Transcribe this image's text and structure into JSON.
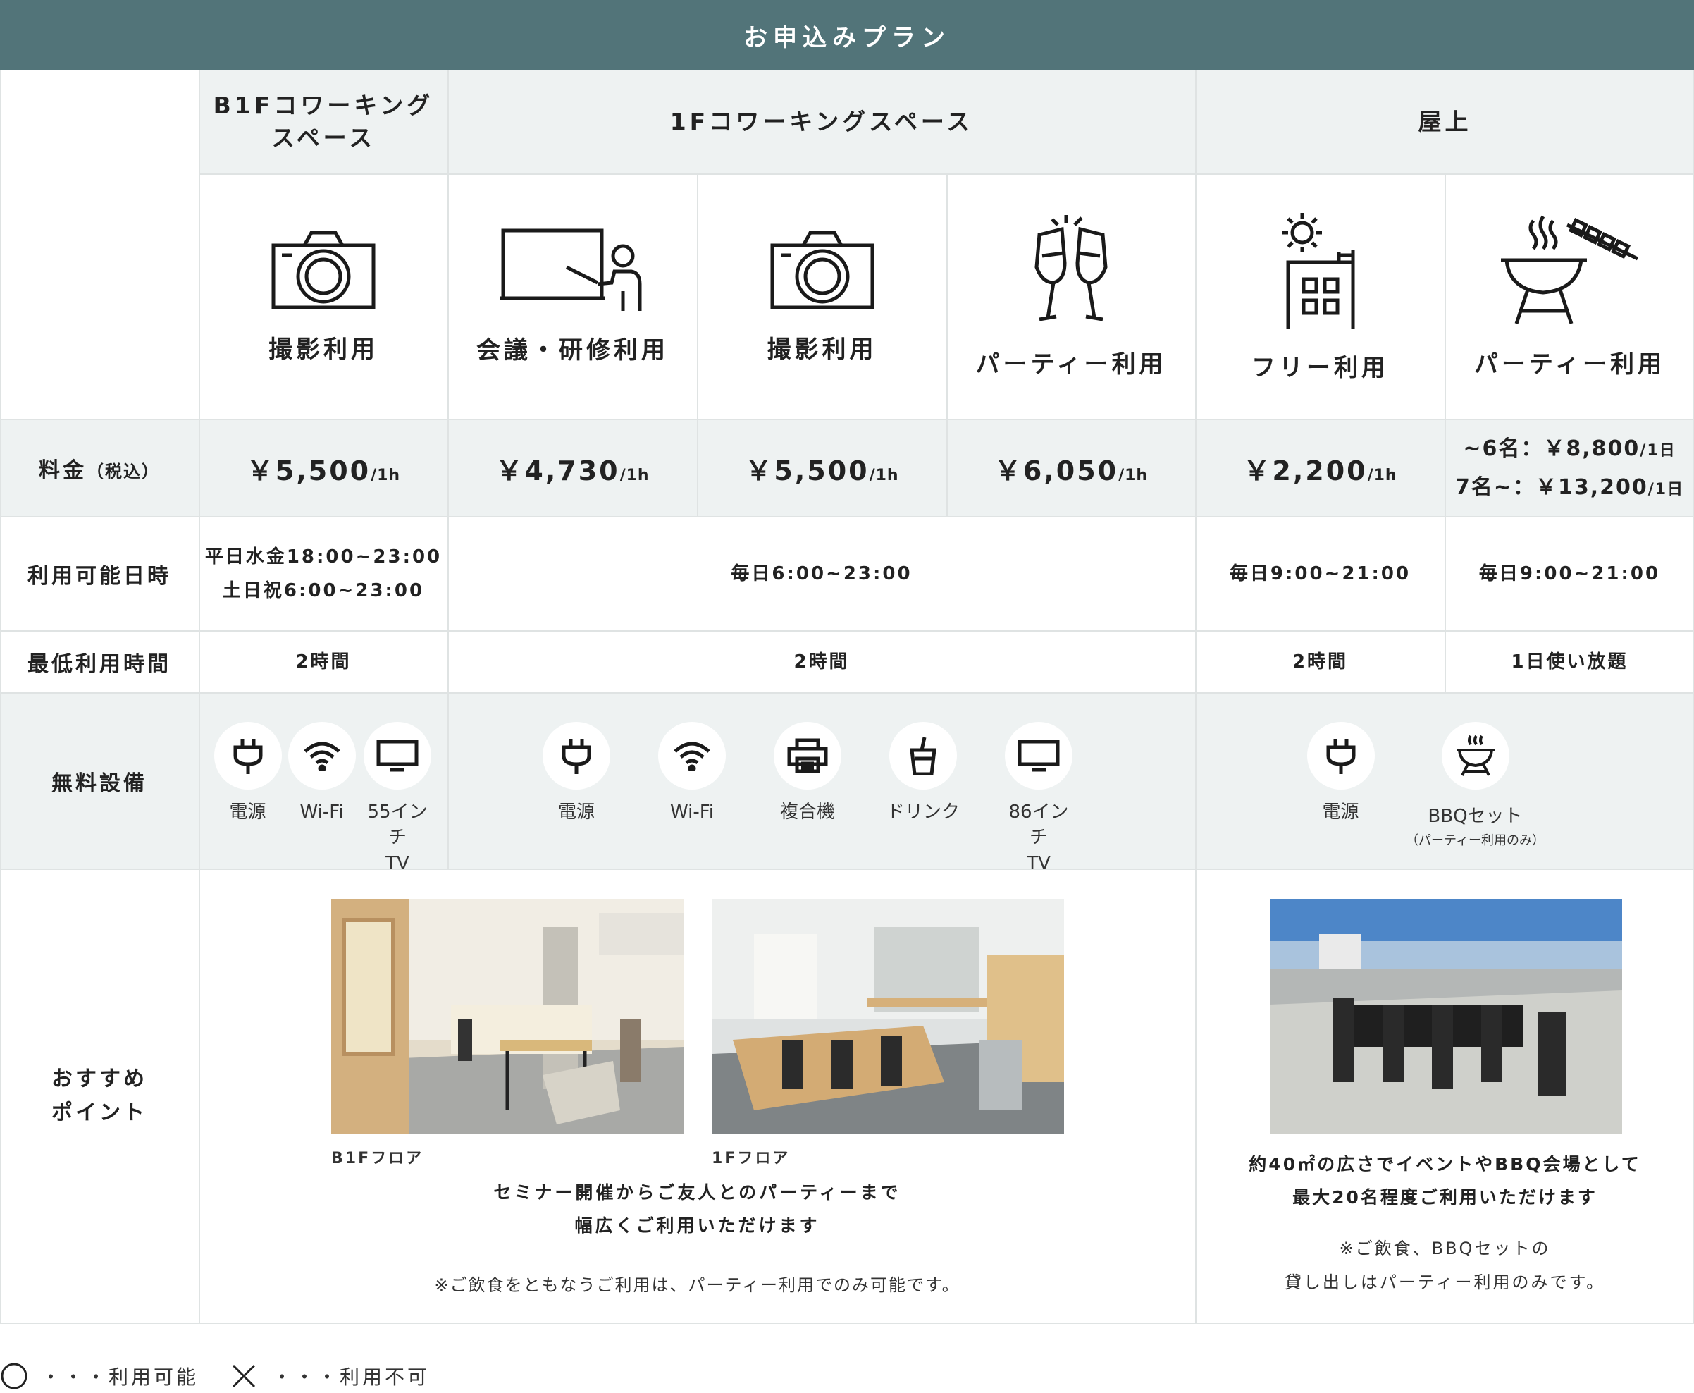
{
  "banner": {
    "title": "お申込みプラン"
  },
  "areas": [
    {
      "name": "B1Fコワーキング\nスペース"
    },
    {
      "name": "1Fコワーキングスペース"
    },
    {
      "name": "屋上"
    }
  ],
  "plans": [
    {
      "icon": "camera-icon",
      "usage": "撮影利用",
      "price": "￥5,500",
      "unit": "/1h"
    },
    {
      "icon": "presentation-icon",
      "usage": "会議・研修利用",
      "price": "￥4,730",
      "unit": "/1h"
    },
    {
      "icon": "camera-icon",
      "usage": "撮影利用",
      "price": "￥5,500",
      "unit": "/1h"
    },
    {
      "icon": "champagne-toast-icon",
      "usage": "パーティー利用",
      "price": "￥6,050",
      "unit": "/1h"
    },
    {
      "icon": "rooftop-building-icon",
      "usage": "フリー利用",
      "price": "￥2,200",
      "unit": "/1h"
    },
    {
      "icon": "bbq-grill-icon",
      "usage": "パーティー利用",
      "price_lines": [
        {
          "text": "~6名：￥8,800",
          "unit": "/1日"
        },
        {
          "text": "7名~：￥13,200",
          "unit": "/1日"
        }
      ]
    }
  ],
  "row_labels": {
    "price": "料金",
    "price_note": "（税込）",
    "available": "利用可能日時",
    "minimum": "最低利用時間",
    "equipment": "無料設備",
    "points": "おすすめ\nポイント"
  },
  "available": {
    "b1f": "平日水金18:00~23:00\n土日祝6:00~23:00",
    "f1": "毎日6:00~23:00",
    "roof_free": "毎日9:00~21:00",
    "roof_party": "毎日9:00~21:00"
  },
  "minimum": {
    "b1f": "2時間",
    "f1": "2時間",
    "roof_free": "2時間",
    "roof_party": "1日使い放題"
  },
  "equipment": {
    "b1f": [
      {
        "icon": "power-plug-icon",
        "label": "電源"
      },
      {
        "icon": "wifi-icon",
        "label": "Wi-Fi"
      },
      {
        "icon": "tv-icon",
        "label": "55インチ\nTV"
      }
    ],
    "f1": [
      {
        "icon": "power-plug-icon",
        "label": "電源"
      },
      {
        "icon": "wifi-icon",
        "label": "Wi-Fi"
      },
      {
        "icon": "printer-icon",
        "label": "複合機"
      },
      {
        "icon": "drink-icon",
        "label": "ドリンク"
      },
      {
        "icon": "tv-icon",
        "label": "86インチ\nTV"
      }
    ],
    "roof": [
      {
        "icon": "power-plug-icon",
        "label": "電源"
      },
      {
        "icon": "bbq-grill-icon",
        "label": "BBQセット",
        "sub": "（パーティー利用のみ）"
      }
    ]
  },
  "points": {
    "b1f_caption": "B1Fフロア",
    "f1_caption": "1Fフロア",
    "cowork_text": "セミナー開催からご友人とのパーティーまで\n幅広くご利用いただけます",
    "cowork_note": "※ご飲食をともなうご利用は、パーティー利用でのみ可能です。",
    "roof_text": "約40㎡の広さでイベントやBBQ会場として\n最大20名程度ご利用いただけます",
    "roof_note": "※ご飲食、BBQセットの\n貸し出しはパーティー利用のみです。"
  },
  "legend": {
    "available": "・・・利用可能",
    "unavailable": "・・・利用不可"
  },
  "colors": {
    "banner": "#527479",
    "row_gray": "#eef2f2",
    "border": "#dfe3e3"
  }
}
